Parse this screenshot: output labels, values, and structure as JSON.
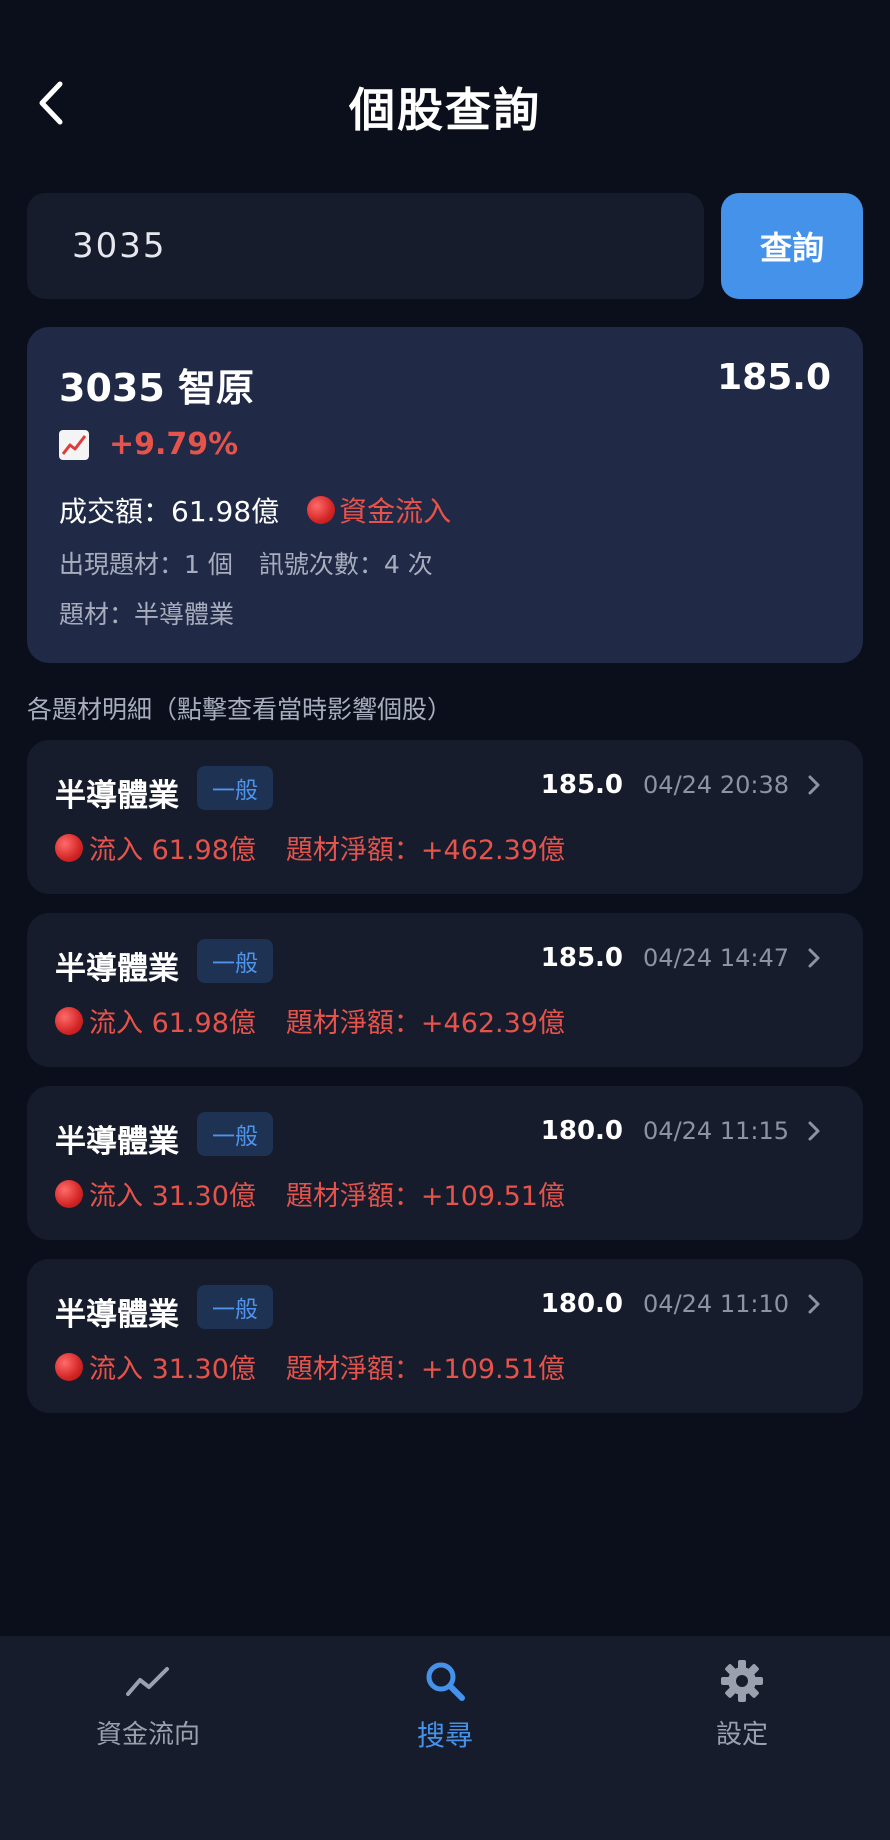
{
  "header": {
    "title": "個股查詢"
  },
  "search": {
    "value": "3035",
    "button_label": "查詢"
  },
  "summary": {
    "name": "3035 智原",
    "price": "185.0",
    "change": "+9.79%",
    "turnover": "成交額：61.98億",
    "flow_label": "資金流入",
    "themes_count": "出現題材：1 個",
    "signal_count": "訊號次數：4 次",
    "theme": "題材：半導體業"
  },
  "section_title": "各題材明細（點擊查看當時影響個股）",
  "details": [
    {
      "topic": "半導體業",
      "badge": "一般",
      "price": "185.0",
      "time": "04/24 20:38",
      "flow": "流入 61.98億",
      "net": "題材淨額：+462.39億"
    },
    {
      "topic": "半導體業",
      "badge": "一般",
      "price": "185.0",
      "time": "04/24 14:47",
      "flow": "流入 61.98億",
      "net": "題材淨額：+462.39億"
    },
    {
      "topic": "半導體業",
      "badge": "一般",
      "price": "180.0",
      "time": "04/24 11:15",
      "flow": "流入 31.30億",
      "net": "題材淨額：+109.51億"
    },
    {
      "topic": "半導體業",
      "badge": "一般",
      "price": "180.0",
      "time": "04/24 11:10",
      "flow": "流入 31.30億",
      "net": "題材淨額：+109.51億"
    }
  ],
  "tabs": [
    {
      "label": "資金流向",
      "icon": "trend-icon"
    },
    {
      "label": "搜尋",
      "icon": "search-icon"
    },
    {
      "label": "設定",
      "icon": "gear-icon"
    }
  ],
  "colors": {
    "accent": "#4492ea",
    "inflow_red": "#e5534b",
    "card": "#171c2c",
    "summary_card": "#202945"
  }
}
